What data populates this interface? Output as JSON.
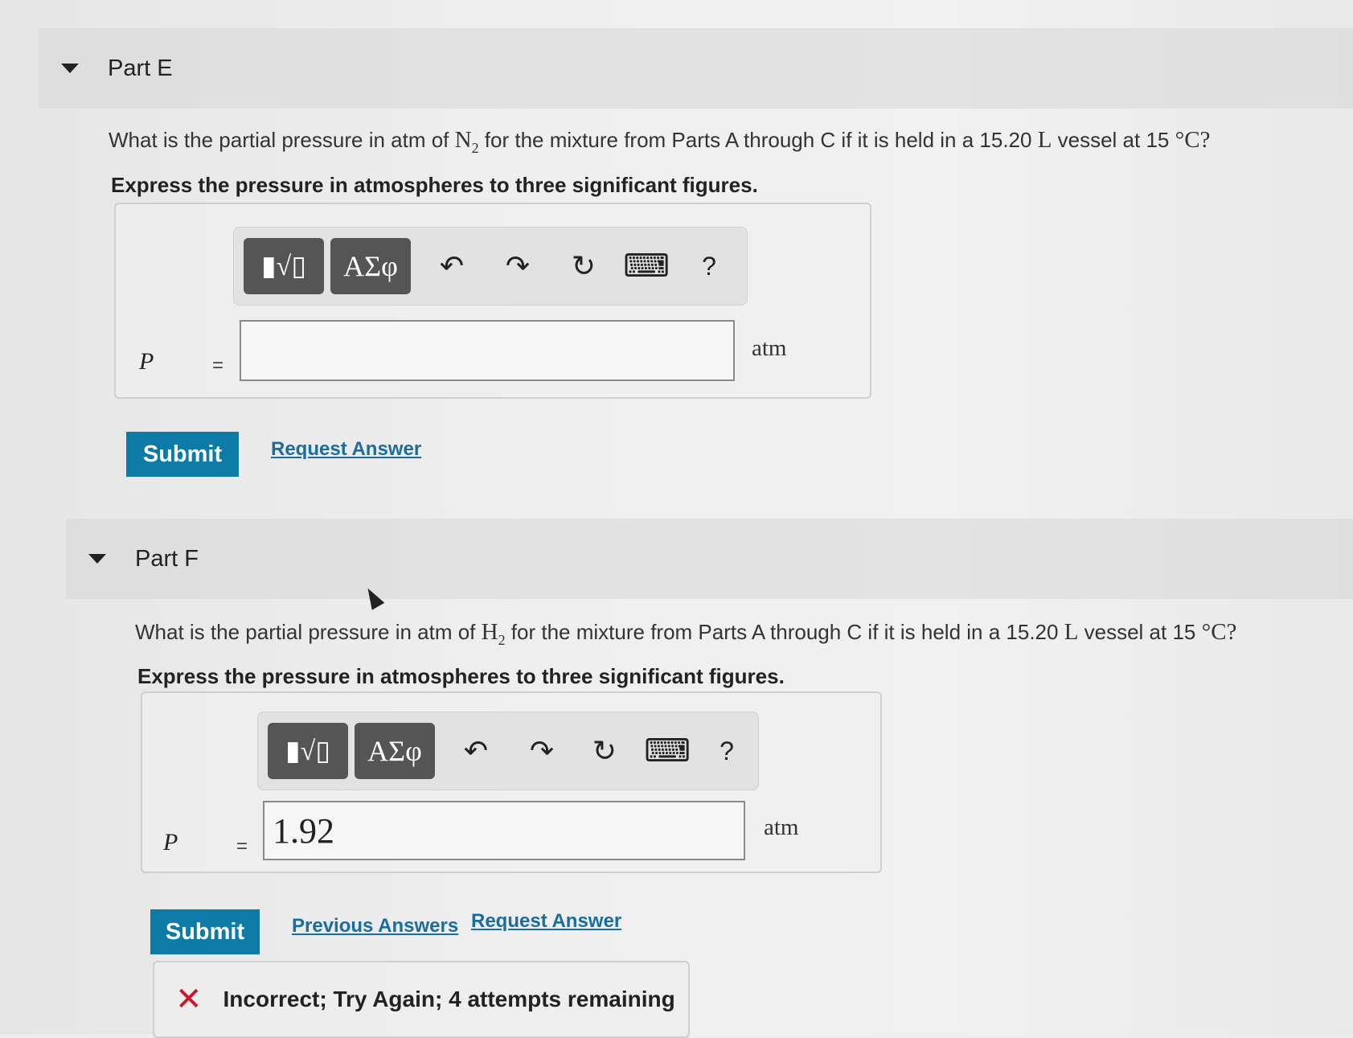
{
  "part_e": {
    "title": "Part E",
    "question_pre": "What is the partial pressure in atm of ",
    "species_symbol": "N",
    "species_subscript": "2",
    "question_mid": " for the mixture from Parts A through C if it is held in a 15.20 ",
    "volume_unit": "L",
    "question_post": " vessel at 15 ",
    "temp_unit": "°C?",
    "instruction": "Express the pressure in atmospheres to three significant figures.",
    "variable": "P",
    "equals": "=",
    "input_value": "",
    "unit": "atm",
    "submit_label": "Submit",
    "request_answer_label": "Request Answer"
  },
  "part_f": {
    "title": "Part F",
    "question_pre": "What is the partial pressure in atm of ",
    "species_symbol": "H",
    "species_subscript": "2",
    "question_mid": " for the mixture from Parts A through C if it is held in a 15.20 ",
    "volume_unit": "L",
    "question_post": " vessel at 15 ",
    "temp_unit": "°C?",
    "instruction": "Express the pressure in atmospheres to three significant figures.",
    "variable": "P",
    "equals": "=",
    "input_value": "1.92",
    "unit": "atm",
    "submit_label": "Submit",
    "previous_answers_label": "Previous Answers",
    "request_answer_label": "Request Answer",
    "feedback": "Incorrect; Try Again; 4 attempts remaining"
  },
  "toolbar": {
    "templates_icon": "▮√▯",
    "greek_label": "ΑΣφ",
    "undo_icon": "↶",
    "redo_icon": "↷",
    "reset_icon": "↻",
    "keyboard_icon": "⌨",
    "help_label": "?"
  },
  "colors": {
    "submit_bg": "#0e7aa8",
    "link": "#1a6d9e",
    "error": "#d1142b"
  }
}
